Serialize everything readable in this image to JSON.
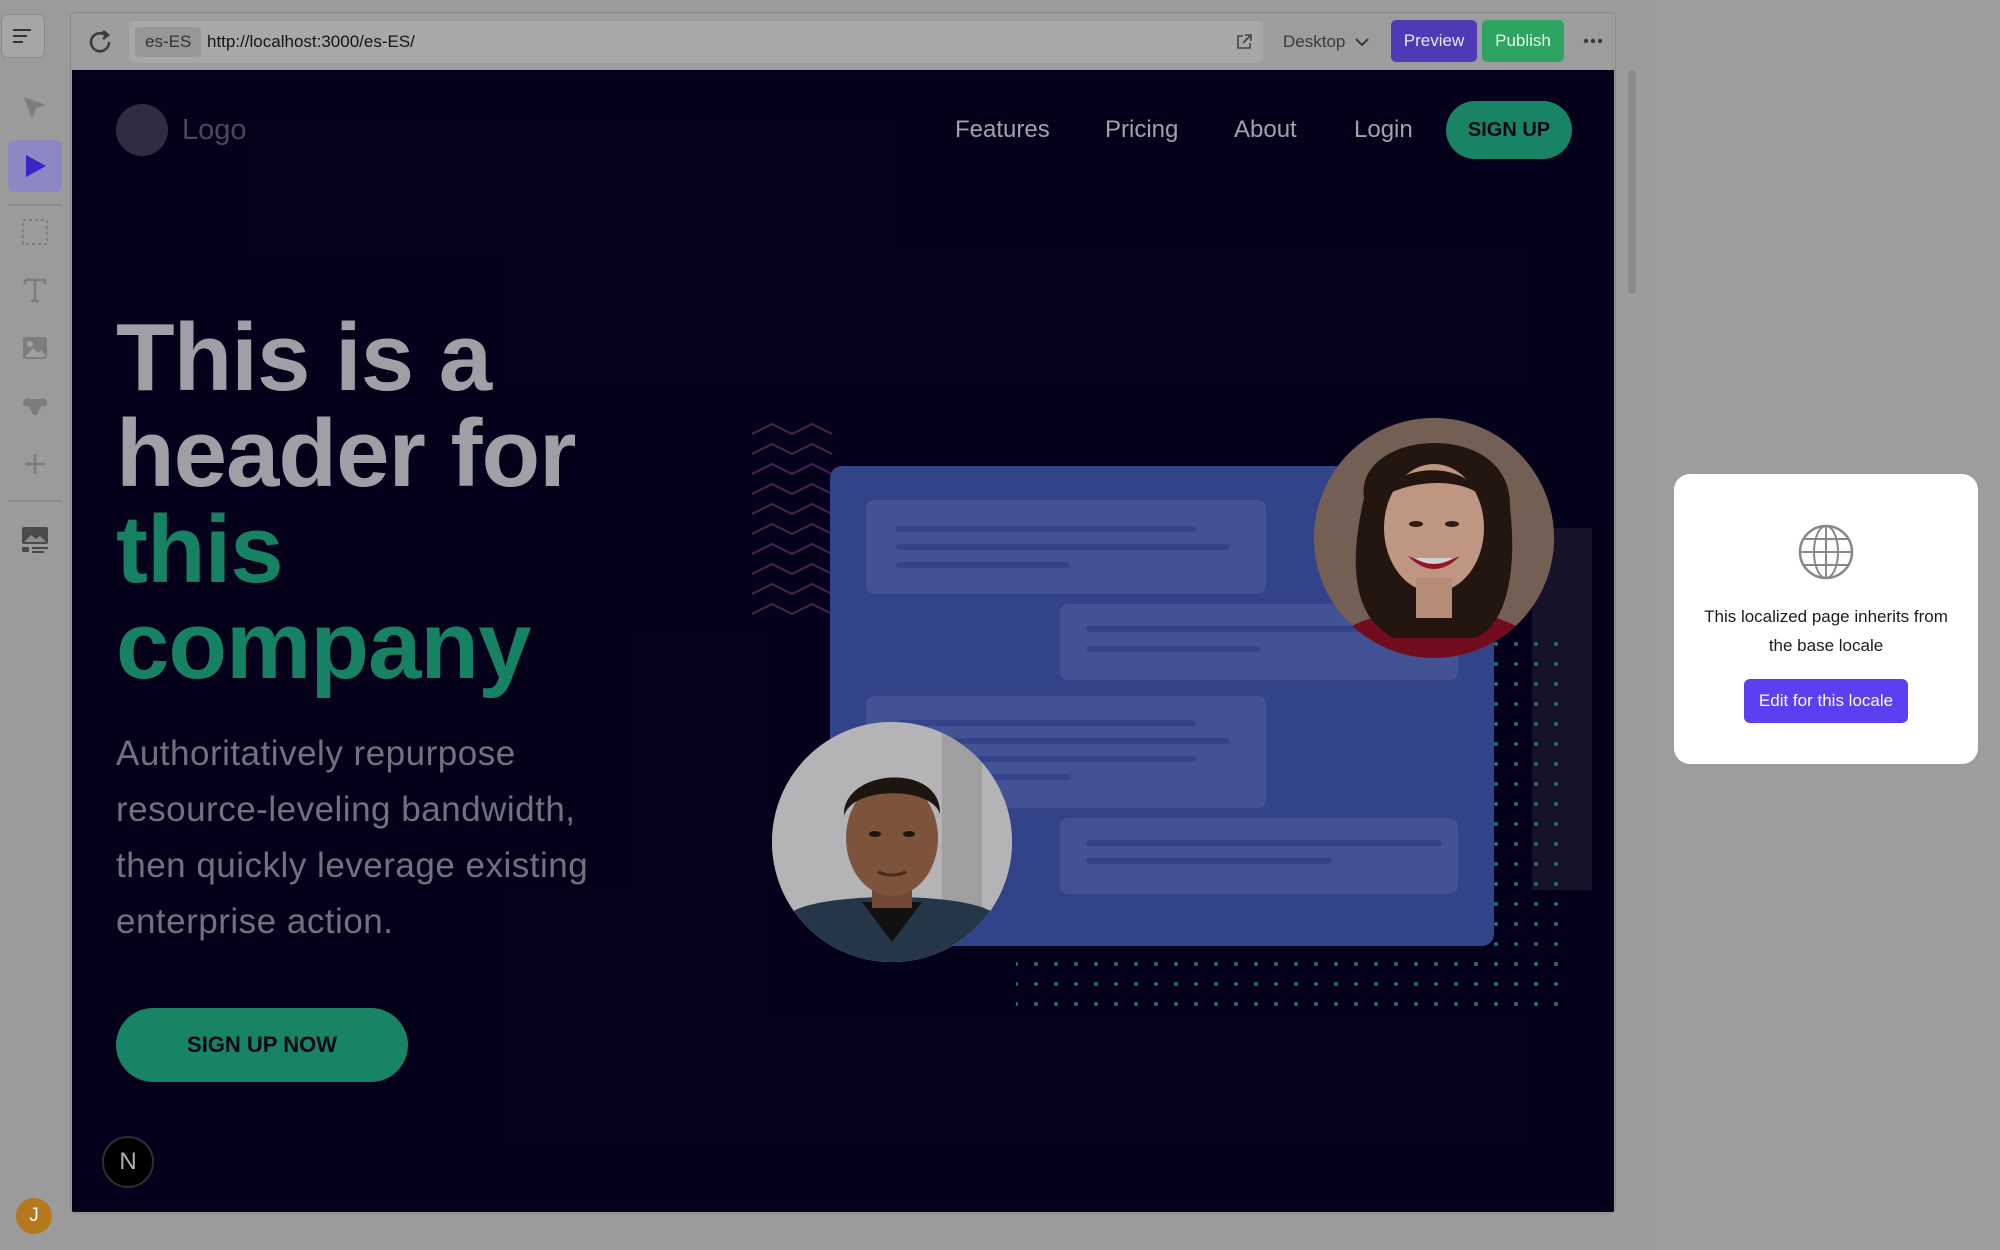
{
  "browser": {
    "locale": "es-ES",
    "url": "http://localhost:3000/es-ES/",
    "device": "Desktop",
    "preview_label": "Preview",
    "publish_label": "Publish"
  },
  "site": {
    "logo_text": "Logo",
    "nav": [
      "Features",
      "Pricing",
      "About",
      "Login"
    ],
    "nav_signup": "SIGN UP",
    "headline_white": [
      "This is a",
      "header for"
    ],
    "headline_green": [
      "this",
      "company"
    ],
    "paragraph": "Authoritatively repurpose resource-leveling bandwidth, then quickly leverage existing enterprise action.",
    "cta": "SIGN UP NOW",
    "badge": "N"
  },
  "popover": {
    "icon": "globe-icon",
    "message": "This localized page inherits from the base locale",
    "button_label": "Edit for this locale"
  },
  "user": {
    "avatar_initial": "J"
  },
  "colors": {
    "accent_green": "#1fa07c",
    "accent_purple": "#5b3ff0",
    "site_bg": "#080222",
    "card_blue": "#3e52a8"
  }
}
